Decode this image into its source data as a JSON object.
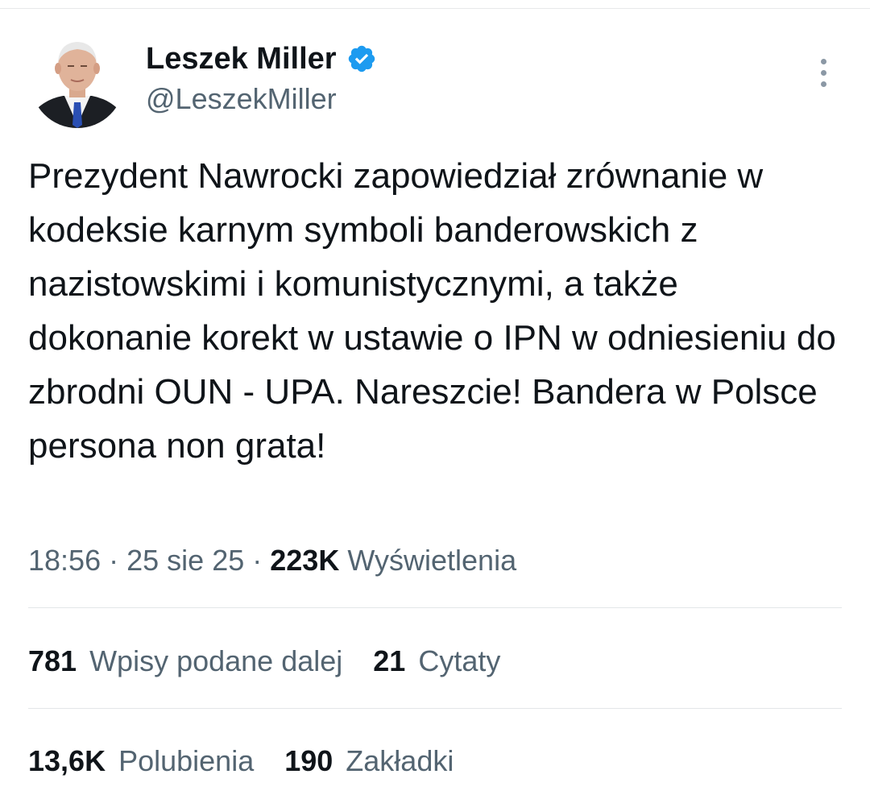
{
  "author": {
    "display_name": "Leszek Miller",
    "handle": "@LeszekMiller",
    "avatar_icon": "profile-photo",
    "verified_icon": "verified-badge-icon",
    "verified_color": "#1d9bf0"
  },
  "tweet": {
    "text": "Prezydent Nawrocki zapowiedział zrównanie w kodeksie karnym symboli banderowskich z nazistowskimi i komunistycznymi, a także dokonanie korekt w ustawie o IPN w odniesieniu do zbrodni OUN - UPA. Nareszcie! Bandera w Polsce persona non grata!",
    "time": "18:56",
    "separator": "·",
    "date": "25 sie 25",
    "views_count": "223K",
    "views_label": "Wyświetlenia"
  },
  "stats": {
    "reposts_count": "781",
    "reposts_label": "Wpisy podane dalej",
    "quotes_count": "21",
    "quotes_label": "Cytaty",
    "likes_count": "13,6K",
    "likes_label": "Polubienia",
    "bookmarks_count": "190",
    "bookmarks_label": "Zakładki"
  },
  "colors": {
    "primary_text": "#0f1419",
    "secondary_text": "#536471",
    "divider": "#e3e6e8"
  },
  "icons": {
    "more": "more-vertical-icon"
  }
}
